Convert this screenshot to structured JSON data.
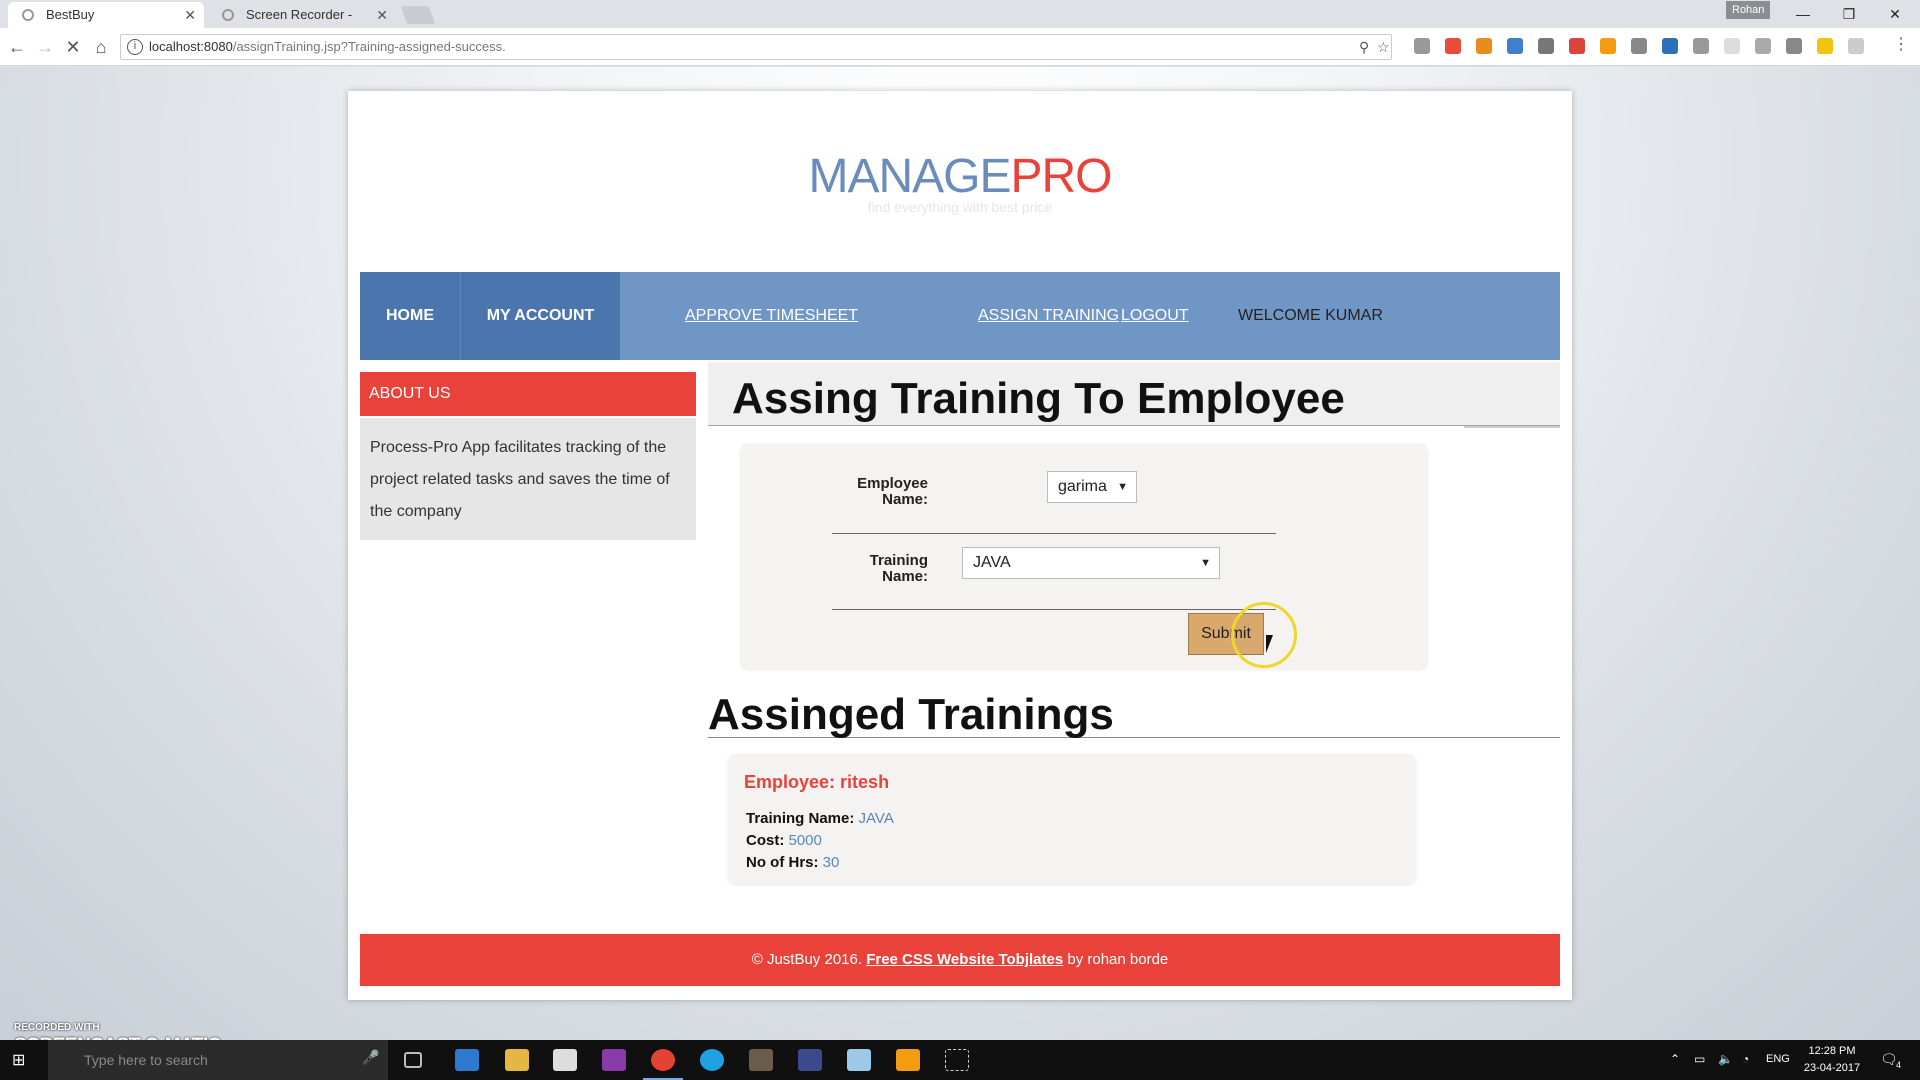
{
  "browser": {
    "tabs": [
      {
        "title": "BestBuy"
      },
      {
        "title": "Screen Recorder - Recor"
      }
    ],
    "profile": "Rohan",
    "url_host": "localhost:8080",
    "url_path": "/assignTraining.jsp?Training-assigned-success."
  },
  "site": {
    "logo_part1": "MANAGE",
    "logo_part2": "PRO",
    "tagline": "find everything with best price"
  },
  "nav": {
    "home": "HOME",
    "my_account": "MY ACCOUNT",
    "approve_timesheet": "APPROVE TIMESHEET",
    "assign_training": "ASSIGN TRAINING",
    "logout": "LOGOUT",
    "welcome": "WELCOME KUMAR"
  },
  "sidebar": {
    "title": "ABOUT US",
    "text": "Process-Pro App facilitates tracking of the project related tasks and saves the time of the company"
  },
  "form": {
    "title": "Assing Training To Employee",
    "employee_label": "Employee Name:",
    "employee_value": "garima",
    "training_label": "Training Name:",
    "training_value": "JAVA",
    "submit_label": "Submit"
  },
  "assigned": {
    "title": "Assinged Trainings",
    "items": [
      {
        "employee_label": "Employee:",
        "employee": "ritesh",
        "training_label": "Training Name:",
        "training": "JAVA",
        "cost_label": "Cost:",
        "cost": "5000",
        "hours_label": "No of Hrs:",
        "hours": "30"
      }
    ]
  },
  "footer": {
    "prefix": "© JustBuy 2016.",
    "link": "Free CSS Website Tobjlates",
    "suffix": "by rohan borde"
  },
  "watermark": {
    "line1": "RECORDED WITH",
    "line2": "SCREENCAST-O-MATIC"
  },
  "taskbar": {
    "search_placeholder": "Type here to search",
    "language": "ENG",
    "time": "12:28 PM",
    "date": "23-04-2017",
    "notification_count": "4"
  }
}
